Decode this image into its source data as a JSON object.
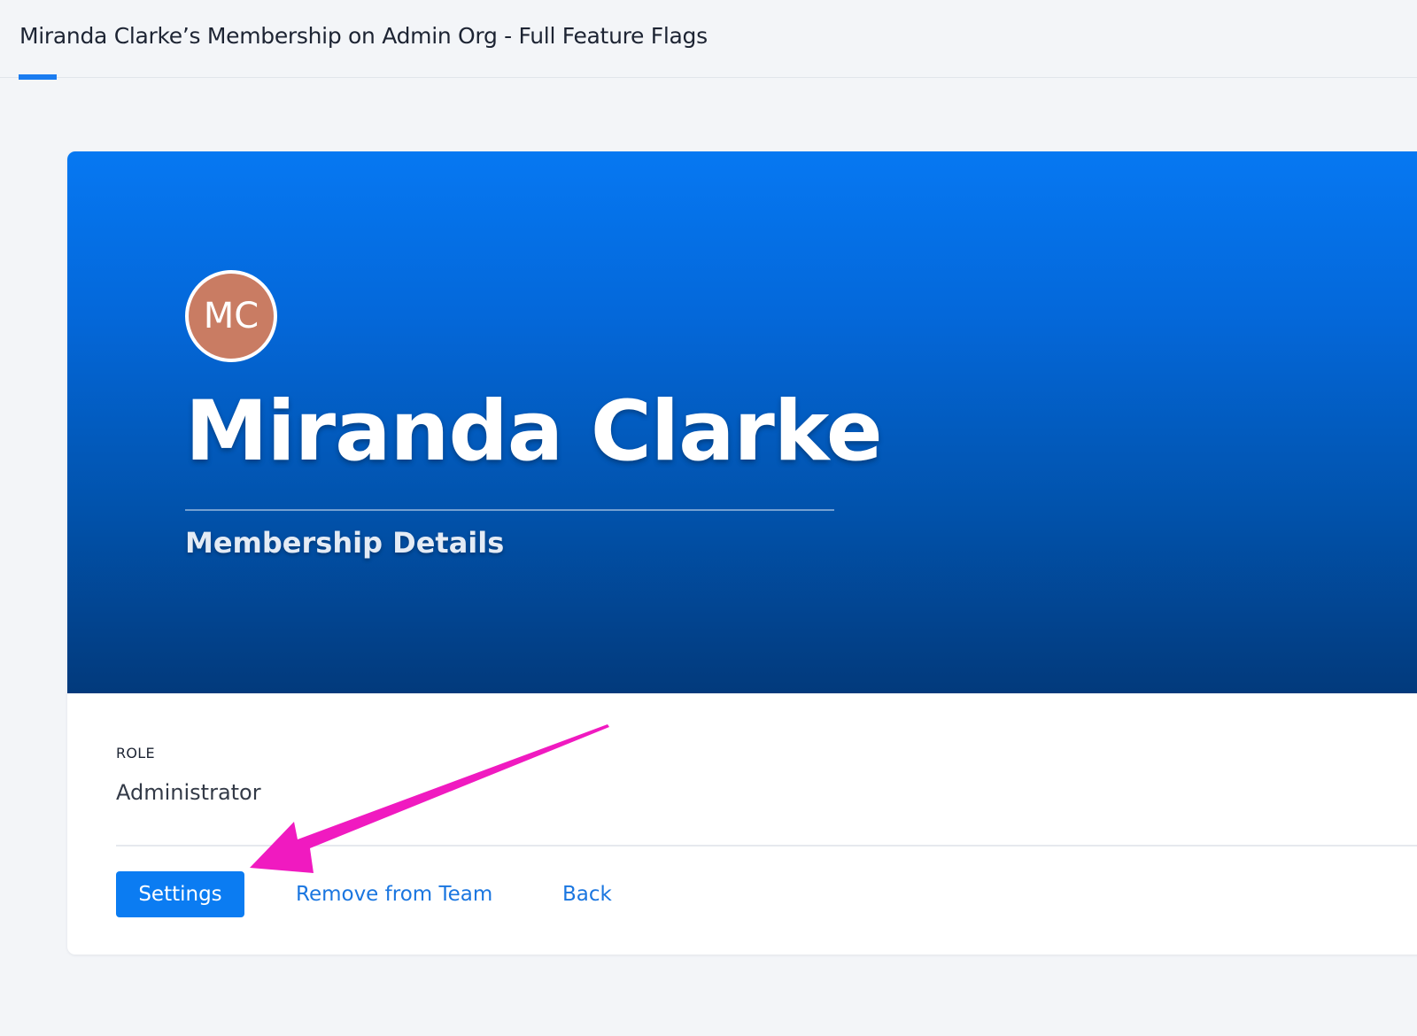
{
  "header": {
    "title": "Miranda Clarke’s Membership on Admin Org - Full Feature Flags"
  },
  "profile": {
    "initials": "MC",
    "avatar_color": "#c97c63",
    "name": "Miranda Clarke",
    "subtitle": "Membership Details"
  },
  "details": {
    "role_label": "ROLE",
    "role_value": "Administrator"
  },
  "actions": {
    "settings_label": "Settings",
    "remove_label": "Remove from Team",
    "back_label": "Back"
  },
  "colors": {
    "accent": "#0b7cf2",
    "link": "#1a76e0",
    "hero_top": "#0678f2",
    "hero_bottom": "#023a7c",
    "annotation": "#f01ac0"
  }
}
